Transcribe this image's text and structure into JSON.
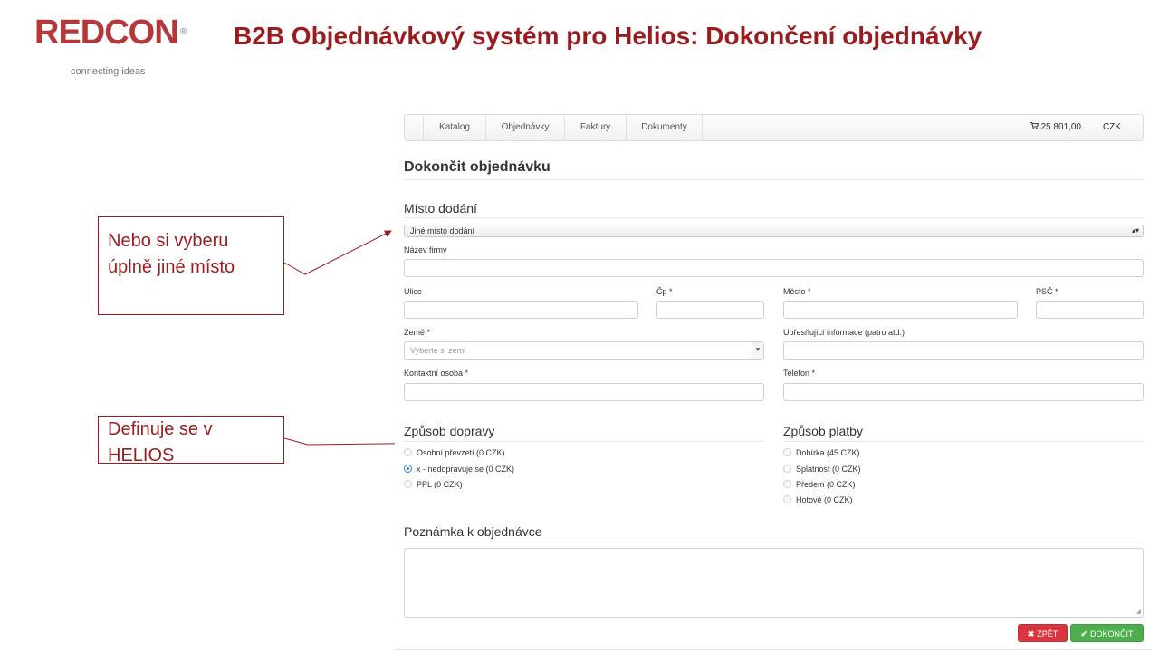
{
  "slide": {
    "title": "B2B Objednávkový systém pro Helios: Dokončení objednávky"
  },
  "logo": {
    "word": "REDCON",
    "registered": "®",
    "tagline": "connecting ideas",
    "brand_color": "#b5373a"
  },
  "callouts": {
    "first": {
      "line1": "Nebo si vyberu",
      "line2": "úplně jiné místo"
    },
    "second": {
      "line1": "Definuje se v",
      "line2": "HELIOS"
    },
    "color": "#9b1c1f"
  },
  "navbar": {
    "items": [
      "Katalog",
      "Objednávky",
      "Faktury",
      "Dokumenty"
    ],
    "cart_icon": "shopping-cart-icon",
    "cart_total": "25 801,00",
    "currency": "CZK"
  },
  "page": {
    "title": "Dokončit objednávku"
  },
  "delivery_place": {
    "title": "Místo dodání",
    "selected": "Jiné místo dodání",
    "labels": {
      "company": "Název firmy",
      "street": "Ulice",
      "number": "Čp *",
      "city": "Město *",
      "zip": "PSČ *",
      "country": "Země *",
      "extra": "Upřesňující informace (patro atd.)",
      "contact": "Kontaktní osoba *",
      "phone": "Telefon *"
    },
    "country_placeholder": "Vyberte si zemi"
  },
  "shipping": {
    "title": "Způsob dopravy",
    "options": [
      {
        "label": "Osobní převzetí (0  CZK)",
        "checked": false
      },
      {
        "label": "x - nedopravuje se (0  CZK)",
        "checked": true
      },
      {
        "label": "PPL (0  CZK)",
        "checked": false
      }
    ]
  },
  "payment": {
    "title": "Způsob platby",
    "options": [
      {
        "label": "Dobírka (45  CZK)",
        "checked": false
      },
      {
        "label": "Splatnost (0  CZK)",
        "checked": false
      },
      {
        "label": "Předem (0  CZK)",
        "checked": false
      },
      {
        "label": "Hotově (0  CZK)",
        "checked": false
      }
    ]
  },
  "note": {
    "title": "Poznámka k objednávce"
  },
  "buttons": {
    "back": "ZPĚT",
    "back_icon": "close-icon",
    "finish": "DOKONČIT",
    "finish_icon": "check-icon",
    "back_color": "#d9363e",
    "finish_color": "#4cae4c"
  }
}
